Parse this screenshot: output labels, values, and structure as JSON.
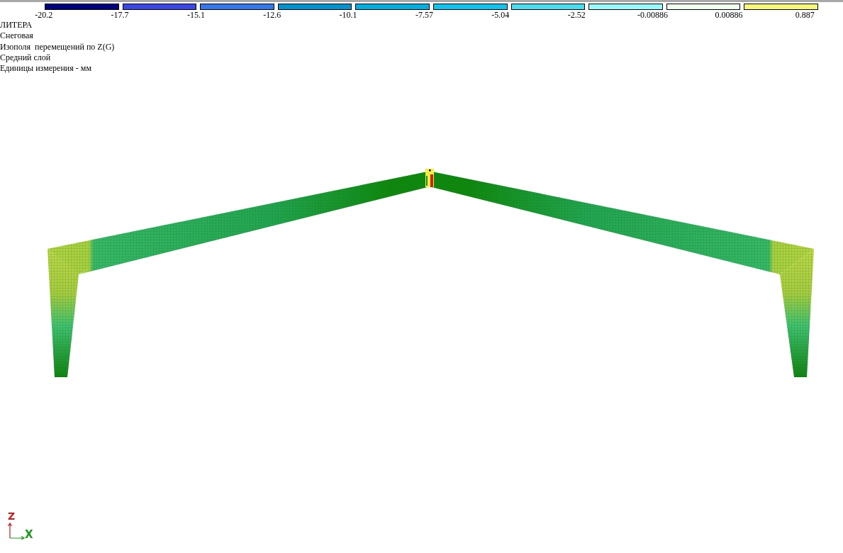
{
  "legend": {
    "swatches": [
      {
        "color": "#000080"
      },
      {
        "color": "#3a48e8"
      },
      {
        "color": "#3478ee"
      },
      {
        "color": "#0094d0"
      },
      {
        "color": "#00aee0"
      },
      {
        "color": "#10c4f0"
      },
      {
        "color": "#48def0"
      },
      {
        "color": "#98fafa"
      },
      {
        "color": "#f0fff0"
      },
      {
        "color": "#f8f878"
      }
    ],
    "labels": [
      "-20.2",
      "-17.7",
      "-15.1",
      "-12.6",
      "-10.1",
      "-7.57",
      "-5.04",
      "-2.52",
      "-0.00886",
      "0.00886",
      "0.887"
    ]
  },
  "info_lines": [
    "ЛИТЕРА",
    "Снеговая",
    "Изополя  перемещений по Z(G)",
    "Средний слой",
    "Единицы измерения - мм"
  ],
  "axes": {
    "vertical": "Z",
    "horizontal": "X"
  }
}
